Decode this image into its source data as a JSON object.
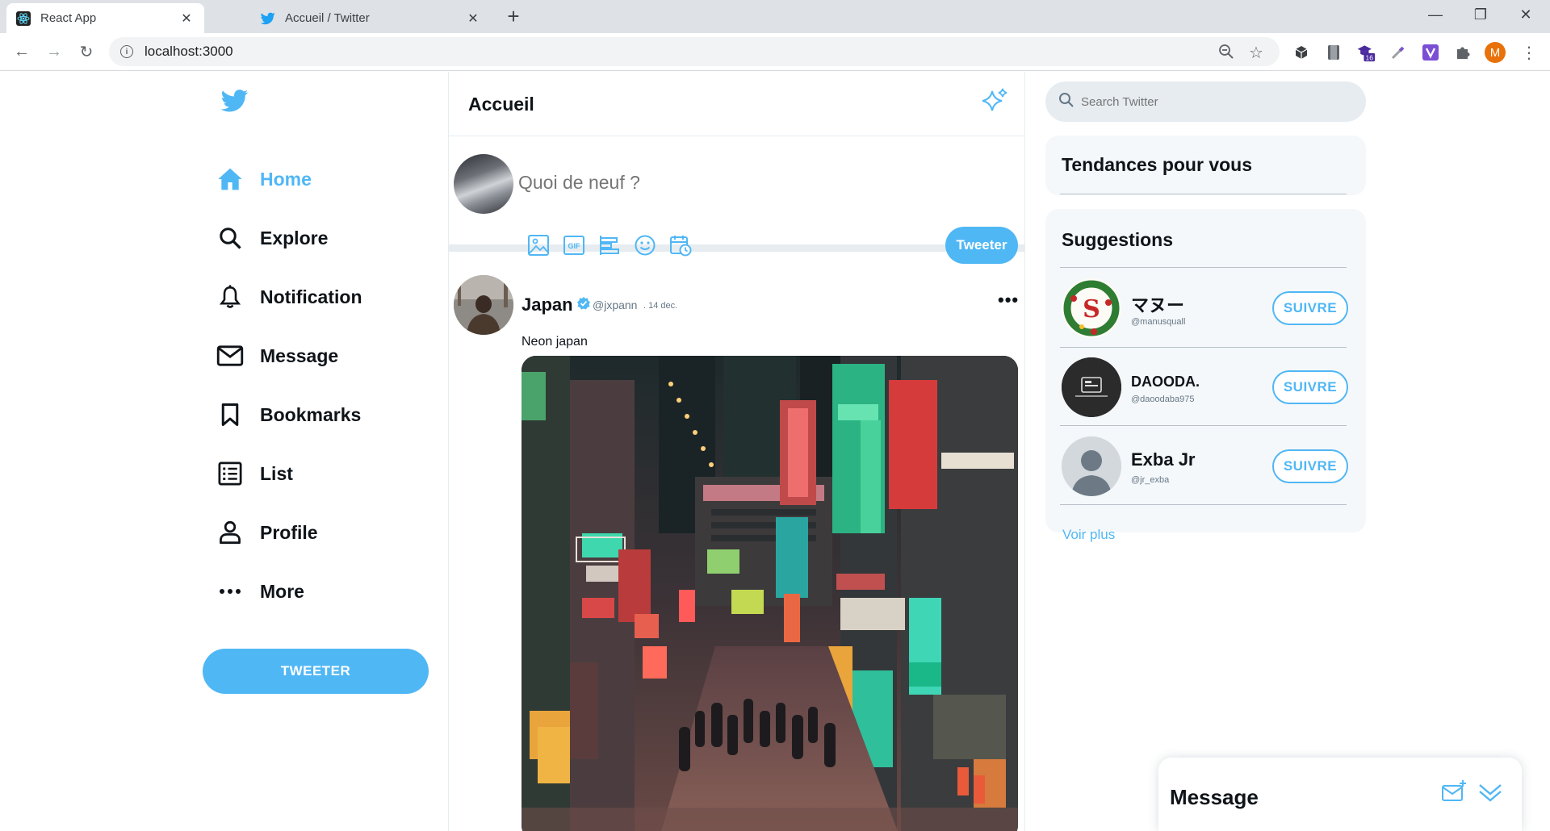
{
  "browser": {
    "tabs": [
      {
        "title": "React App",
        "icon": "react-icon",
        "active": true
      },
      {
        "title": "Accueil / Twitter",
        "icon": "twitter-icon",
        "active": false
      }
    ],
    "url": "localhost:3000",
    "profile_initial": "M",
    "extension_badge": "16"
  },
  "sidebar": {
    "items": [
      {
        "label": "Home",
        "icon": "home-icon",
        "active": true
      },
      {
        "label": "Explore",
        "icon": "search-icon"
      },
      {
        "label": "Notification",
        "icon": "bell-icon"
      },
      {
        "label": "Message",
        "icon": "mail-icon"
      },
      {
        "label": "Bookmarks",
        "icon": "bookmark-icon"
      },
      {
        "label": "List",
        "icon": "list-icon"
      },
      {
        "label": "Profile",
        "icon": "user-icon"
      },
      {
        "label": "More",
        "icon": "more-icon"
      }
    ],
    "tweet_button": "TWEETER"
  },
  "feed": {
    "title": "Accueil",
    "composer": {
      "placeholder": "Quoi de neuf ?",
      "tweet_button": "Tweeter"
    },
    "post": {
      "name": "Japan",
      "handle": "@jxpann",
      "date": ". 14 dec.",
      "more": "•••",
      "text": "Neon japan"
    }
  },
  "right": {
    "search_placeholder": "Search Twitter",
    "trends_title": "Tendances pour vous",
    "suggestions_title": "Suggestions",
    "suggestions": [
      {
        "name": "マヌー",
        "handle": "@manusquall",
        "follow": "SUIVRE"
      },
      {
        "name": "DAOODA.",
        "handle": "@daoodaba975",
        "follow": "SUIVRE"
      },
      {
        "name": "Exba Jr",
        "handle": "@jr_exba",
        "follow": "SUIVRE"
      }
    ],
    "see_more": "Voir plus"
  },
  "message_dock": {
    "title": "Message"
  },
  "colors": {
    "accent": "#50b7f5",
    "text": "#0f1419",
    "muted": "#657786",
    "border": "#e6ecf0"
  }
}
